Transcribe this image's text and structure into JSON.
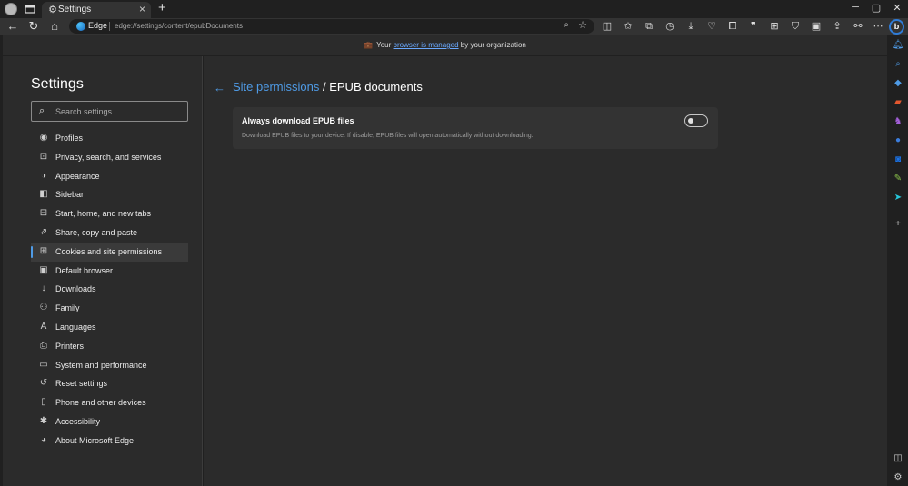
{
  "window": {
    "tab_title": "Settings",
    "tab_close": "×",
    "new_tab": "+",
    "minimize": "─",
    "maximize": "▢",
    "close": "✕"
  },
  "address_bar": {
    "site_label": "Edge",
    "url": "edge://settings/content/epubDocuments"
  },
  "banner": {
    "prefix": "Your",
    "link": "browser is managed",
    "suffix": "by your organization"
  },
  "sidebar": {
    "title": "Settings",
    "search_placeholder": "Search settings",
    "items": [
      {
        "label": "Profiles",
        "icon": "profile-icon"
      },
      {
        "label": "Privacy, search, and services",
        "icon": "lock-icon"
      },
      {
        "label": "Appearance",
        "icon": "palette-icon"
      },
      {
        "label": "Sidebar",
        "icon": "sidebar-icon"
      },
      {
        "label": "Start, home, and new tabs",
        "icon": "home-icon"
      },
      {
        "label": "Share, copy and paste",
        "icon": "share-icon"
      },
      {
        "label": "Cookies and site permissions",
        "icon": "cookie-icon",
        "active": true
      },
      {
        "label": "Default browser",
        "icon": "browser-icon"
      },
      {
        "label": "Downloads",
        "icon": "download-icon"
      },
      {
        "label": "Family",
        "icon": "family-icon"
      },
      {
        "label": "Languages",
        "icon": "language-icon"
      },
      {
        "label": "Printers",
        "icon": "printer-icon"
      },
      {
        "label": "System and performance",
        "icon": "laptop-icon"
      },
      {
        "label": "Reset settings",
        "icon": "reset-icon"
      },
      {
        "label": "Phone and other devices",
        "icon": "phone-icon"
      },
      {
        "label": "Accessibility",
        "icon": "accessibility-icon"
      },
      {
        "label": "About Microsoft Edge",
        "icon": "edge-icon"
      }
    ]
  },
  "main": {
    "breadcrumb_link": "Site permissions",
    "breadcrumb_sep": " / ",
    "page_title": "EPUB documents",
    "setting": {
      "title": "Always download EPUB files",
      "description": "Download EPUB files to your device. If disable, EPUB files will open automatically without downloading.",
      "enabled": false
    }
  },
  "colors": {
    "accent": "#4f9be6",
    "background": "#2b2b2b"
  }
}
